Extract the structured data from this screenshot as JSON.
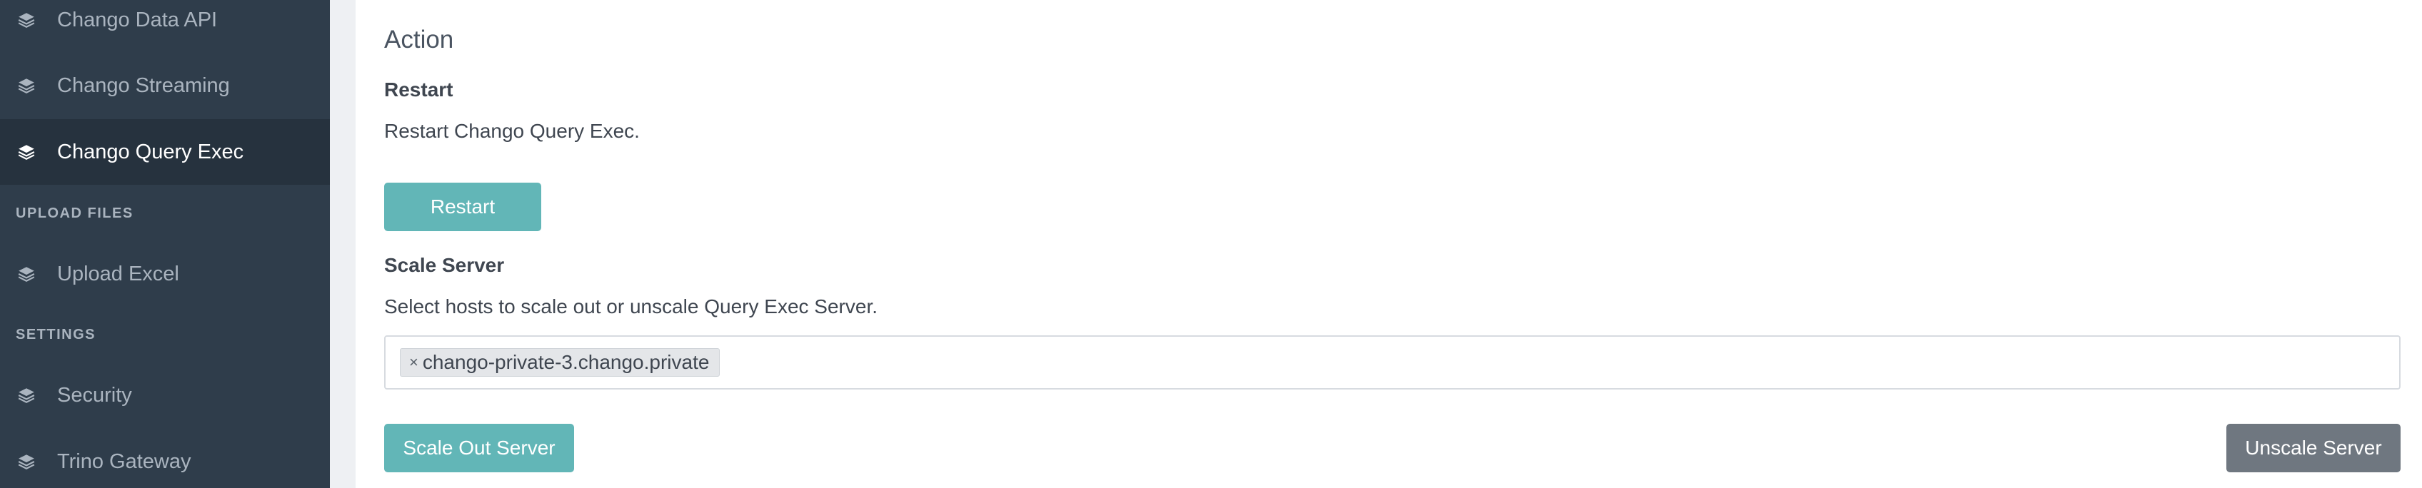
{
  "sidebar": {
    "items": [
      {
        "label": "Chango Data API",
        "icon": "layers-icon"
      },
      {
        "label": "Chango Streaming",
        "icon": "layers-icon"
      },
      {
        "label": "Chango Query Exec",
        "icon": "layers-icon",
        "active": true
      },
      {
        "label": "Upload Excel",
        "icon": "layers-icon"
      },
      {
        "label": "Security",
        "icon": "layers-icon"
      },
      {
        "label": "Trino Gateway",
        "icon": "layers-icon"
      }
    ],
    "headers": {
      "upload_files": "UPLOAD FILES",
      "settings": "SETTINGS"
    }
  },
  "main": {
    "section_title": "Action",
    "restart": {
      "title": "Restart",
      "description": "Restart Chango Query Exec.",
      "button_label": "Restart"
    },
    "scale": {
      "title": "Scale Server",
      "description": "Select hosts to scale out or unscale Query Exec Server.",
      "selected_hosts": [
        "chango-private-3.chango.private"
      ],
      "remove_symbol": "×",
      "scale_out_label": "Scale Out Server",
      "unscale_label": "Unscale Server"
    }
  },
  "colors": {
    "sidebar_bg": "#2f3d4b",
    "sidebar_active_bg": "#26323e",
    "accent_teal": "#62b6b7",
    "secondary_gray": "#6f7780"
  }
}
